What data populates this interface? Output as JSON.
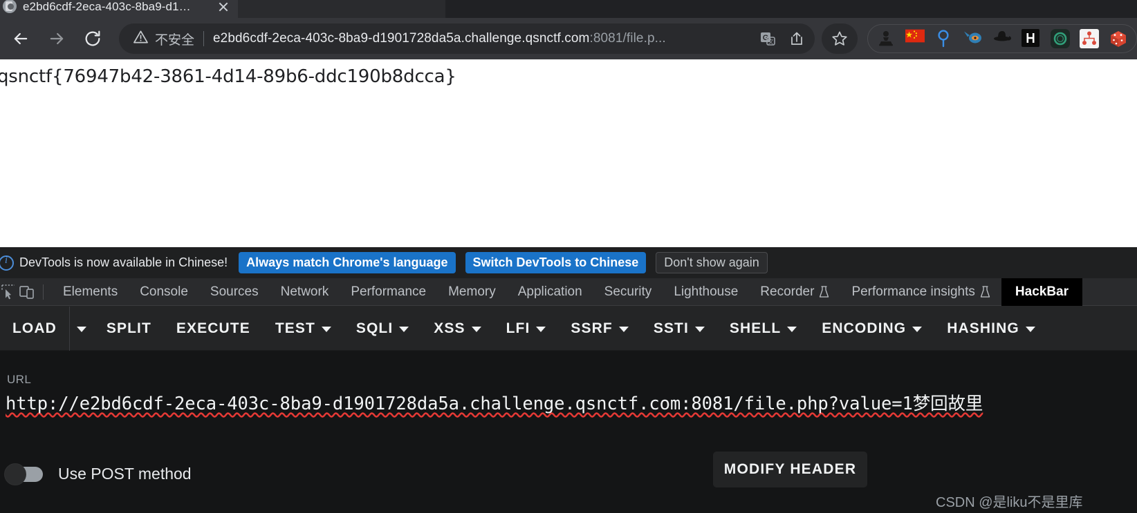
{
  "browser": {
    "tabs": [
      {
        "title": "e2bd6cdf-2eca-403c-8ba9-d1…",
        "active": true,
        "favicon": "page-favicon",
        "close_icon": "close-icon"
      },
      {
        "title": "",
        "active": false,
        "favicon": "",
        "close_icon": "close-icon"
      }
    ],
    "nav": {
      "back_icon": "back-arrow-icon",
      "forward_icon": "forward-arrow-icon",
      "reload_icon": "reload-icon"
    },
    "omnibox": {
      "security_icon": "warning-triangle-icon",
      "security_label": "不安全",
      "url_visible": "e2bd6cdf-2eca-403c-8ba9-d1901728da5a.challenge.qsnctf.com",
      "url_dim_suffix": ":8081/file.p...",
      "translate_icon": "translate-icon",
      "share_icon": "share-icon",
      "bookmark_icon": "star-icon"
    },
    "extensions": [
      {
        "name": "chess-pawn-icon"
      },
      {
        "name": "china-flag-icon"
      },
      {
        "name": "balloon-pin-icon"
      },
      {
        "name": "eye-paddle-icon"
      },
      {
        "name": "black-hat-icon"
      },
      {
        "name": "hackbar-h-icon"
      },
      {
        "name": "green-ring-icon"
      },
      {
        "name": "sitemap-icon"
      },
      {
        "name": "red-dice-icon"
      }
    ]
  },
  "page": {
    "flag_text": "qsnctf{76947b42-3861-4d14-89b6-ddc190b8dcca}"
  },
  "devtools": {
    "infobar": {
      "info_icon": "info-circle-icon",
      "message": "DevTools is now available in Chinese!",
      "buttons": [
        {
          "label": "Always match Chrome's language",
          "style": "primary"
        },
        {
          "label": "Switch DevTools to Chinese",
          "style": "primary"
        },
        {
          "label": "Don't show again",
          "style": "ghost"
        }
      ]
    },
    "toolbar_icons": [
      {
        "name": "inspect-element-icon"
      },
      {
        "name": "device-toolbar-icon"
      }
    ],
    "tabs": [
      {
        "label": "Elements",
        "selected": false,
        "experimental": false
      },
      {
        "label": "Console",
        "selected": false,
        "experimental": false
      },
      {
        "label": "Sources",
        "selected": false,
        "experimental": false
      },
      {
        "label": "Network",
        "selected": false,
        "experimental": false
      },
      {
        "label": "Performance",
        "selected": false,
        "experimental": false
      },
      {
        "label": "Memory",
        "selected": false,
        "experimental": false
      },
      {
        "label": "Application",
        "selected": false,
        "experimental": false
      },
      {
        "label": "Security",
        "selected": false,
        "experimental": false
      },
      {
        "label": "Lighthouse",
        "selected": false,
        "experimental": false
      },
      {
        "label": "Recorder",
        "selected": false,
        "experimental": true
      },
      {
        "label": "Performance insights",
        "selected": false,
        "experimental": true
      },
      {
        "label": "HackBar",
        "selected": true,
        "experimental": false
      }
    ]
  },
  "hackbar": {
    "toolbar": [
      {
        "label": "LOAD",
        "split_caret": true,
        "caret": false
      },
      {
        "label": "SPLIT",
        "split_caret": false,
        "caret": false
      },
      {
        "label": "EXECUTE",
        "split_caret": false,
        "caret": false
      },
      {
        "label": "TEST",
        "split_caret": false,
        "caret": true
      },
      {
        "label": "SQLI",
        "split_caret": false,
        "caret": true
      },
      {
        "label": "XSS",
        "split_caret": false,
        "caret": true
      },
      {
        "label": "LFI",
        "split_caret": false,
        "caret": true
      },
      {
        "label": "SSRF",
        "split_caret": false,
        "caret": true
      },
      {
        "label": "SSTI",
        "split_caret": false,
        "caret": true
      },
      {
        "label": "SHELL",
        "split_caret": false,
        "caret": true
      },
      {
        "label": "ENCODING",
        "split_caret": false,
        "caret": true
      },
      {
        "label": "HASHING",
        "split_caret": false,
        "caret": true
      }
    ],
    "url_field": {
      "label": "URL",
      "value": "http://e2bd6cdf-2eca-403c-8ba9-d1901728da5a.challenge.qsnctf.com:8081/file.php?value=1梦回故里",
      "placeholder": "URL"
    },
    "post_toggle": {
      "label": "Use POST method",
      "enabled": false
    },
    "modify_header_label": "MODIFY HEADER"
  },
  "watermark": "CSDN @是liku不是里库"
}
